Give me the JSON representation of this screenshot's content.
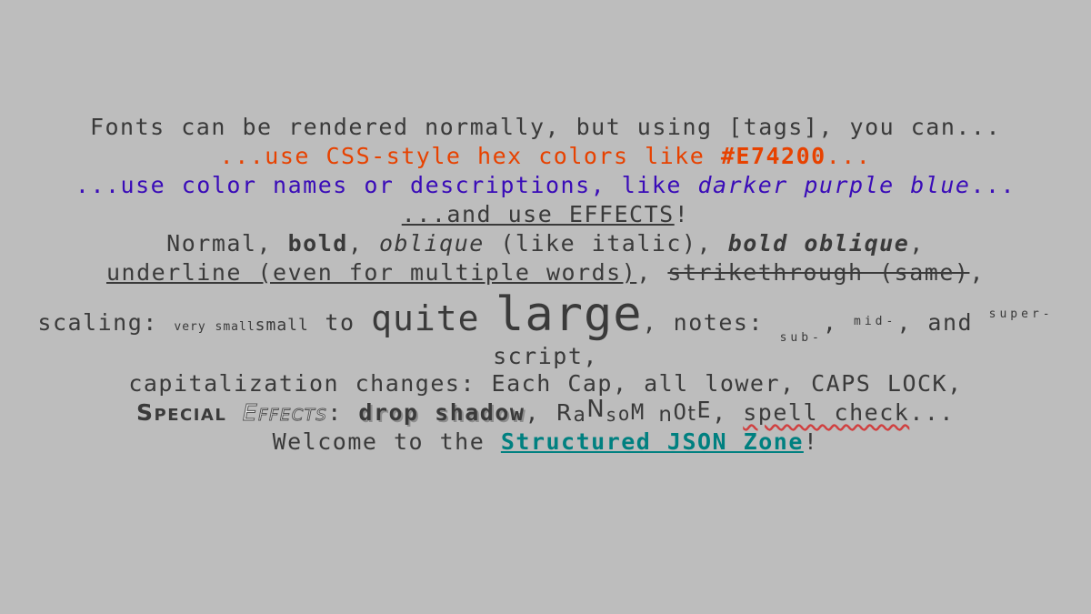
{
  "lines": {
    "l1": "Fonts can be rendered normally, but using [tags], you can...",
    "l2_prefix": "...use CSS-style hex colors like ",
    "l2_hex": "#E74200",
    "l2_suffix": "...",
    "l3_prefix": "...use color names or descriptions, like ",
    "l3_desc": "darker purple blue",
    "l3_suffix": "...",
    "l4_under": "...and use EFFECTS",
    "l4_bang": "!",
    "l5_normal": "Normal,",
    "l5_bold": "bold",
    "l5_comma1": ",",
    "l5_oblique": "oblique",
    "l5_like": "(like italic),",
    "l5_bold_oblique": "bold oblique",
    "l5_comma2": ",",
    "l6_under": "underline (even for multiple words)",
    "l6_comma1": ",",
    "l6_strike": "strikethrough (same)",
    "l6_comma2": ",",
    "l7_scaling": "scaling:",
    "l7_very_small": "very small",
    "l7_small": "small",
    "l7_to": "to",
    "l7_quite": "quite",
    "l7_large": "large",
    "l7_notes": ", notes:",
    "l7_sub": "sub-",
    "l7_c1": ",",
    "l7_mid": "mid-",
    "l7_and": ", and",
    "l7_super": "super-",
    "l8_script": "script,",
    "l9": "capitalization changes: Each Cap, all lower, CAPS LOCK,",
    "l10_special": "Special",
    "l10_effects": "Effects",
    "l10_colon": ":",
    "l10_shadow": "drop shadow",
    "l10_c1": ",",
    "l10_ransom": [
      "R",
      "a",
      "N",
      "s",
      "o",
      "M",
      " ",
      "n",
      "O",
      "t",
      "E"
    ],
    "l10_c2": ",",
    "l10_spell": "spell check",
    "l10_dots": "...",
    "l11_prefix": "Welcome to the ",
    "l11_link": "Structured JSON Zone",
    "l11_bang": "!"
  },
  "colors": {
    "background": "#bdbdbd",
    "text": "#3a3a3a",
    "orange": "#e74200",
    "purple_blue": "#3a0cb8",
    "teal": "#008080"
  }
}
